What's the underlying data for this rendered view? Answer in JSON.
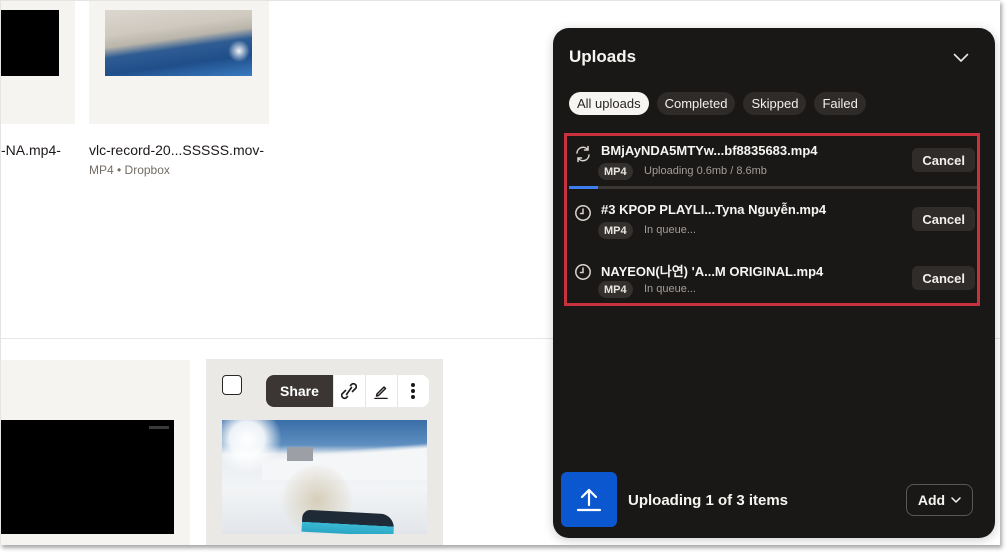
{
  "files_top": [
    {
      "name": "-NA.mp4-",
      "meta": ""
    },
    {
      "name": "vlc-record-20...SSSSS.mov-",
      "meta": "MP4 • Dropbox"
    }
  ],
  "file_actions": {
    "share_label": "Share",
    "icons": [
      "link-icon",
      "pencil-icon",
      "more-vertical-icon"
    ]
  },
  "uploads_panel": {
    "title": "Uploads",
    "filters": [
      {
        "label": "All uploads",
        "active": true
      },
      {
        "label": "Completed",
        "active": false
      },
      {
        "label": "Skipped",
        "active": false
      },
      {
        "label": "Failed",
        "active": false
      }
    ],
    "items": [
      {
        "name": "BMjAyNDA5MTYw...bf8835683.mp4",
        "type": "MP4",
        "status": "Uploading 0.6mb / 8.6mb",
        "icon": "sync-icon",
        "cancel_label": "Cancel",
        "progress_percent": 7
      },
      {
        "name": "#3 KPOP PLAYLI...Tyna Nguyễn.mp4",
        "type": "MP4",
        "status": "In queue...",
        "icon": "clock-icon",
        "cancel_label": "Cancel"
      },
      {
        "name": "NAYEON(나연) 'A...M ORIGINAL.mp4",
        "type": "MP4",
        "status": "In queue...",
        "icon": "clock-icon",
        "cancel_label": "Cancel"
      }
    ],
    "footer": {
      "status": "Uploading 1 of 3 items",
      "add_label": "Add"
    }
  },
  "colors": {
    "panel_bg": "#1a1817",
    "accent_blue": "#0b57d0",
    "progress_blue": "#3d7ff0",
    "highlight_red": "#c8323f"
  }
}
